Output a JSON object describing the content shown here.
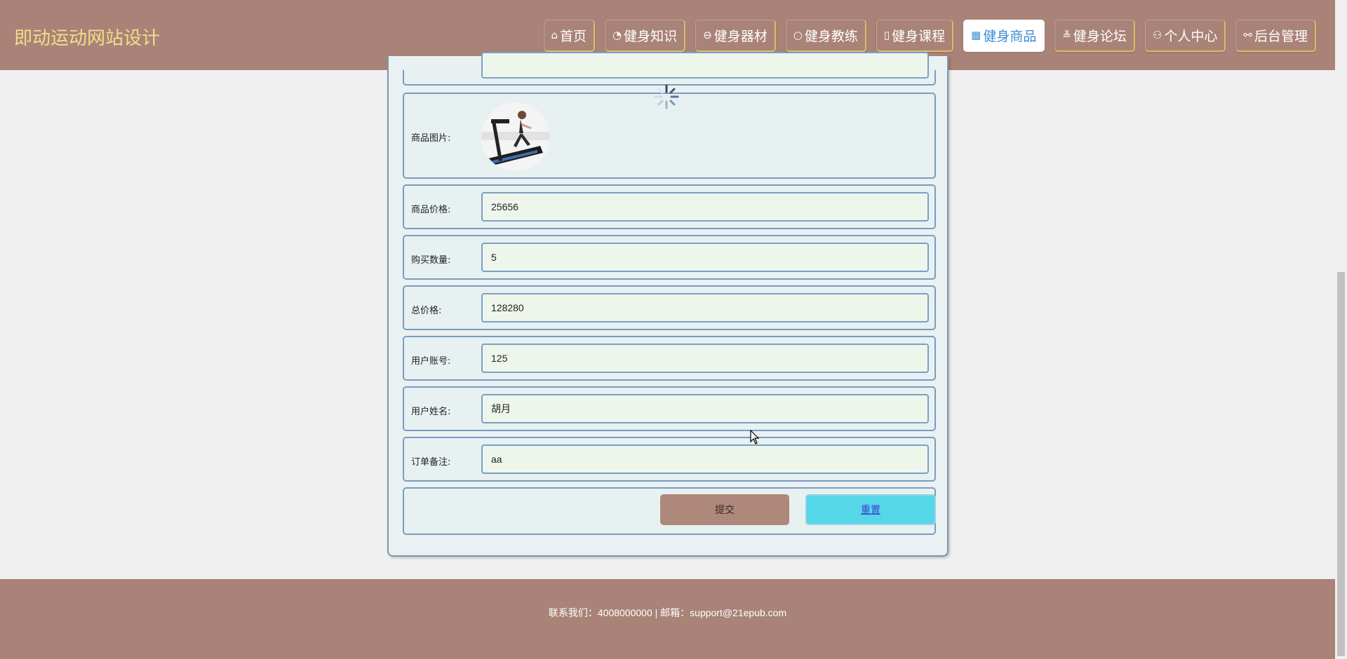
{
  "site": {
    "title": "即动运动网站设计"
  },
  "nav": [
    {
      "label": "首页",
      "icon": "home-icon",
      "glyph": "⌂"
    },
    {
      "label": "健身知识",
      "icon": "dashboard-icon",
      "glyph": "◔"
    },
    {
      "label": "健身器材",
      "icon": "equipment-icon",
      "glyph": "⊖"
    },
    {
      "label": "健身教练",
      "icon": "coach-icon",
      "glyph": "○"
    },
    {
      "label": "健身课程",
      "icon": "course-icon",
      "glyph": "▯"
    },
    {
      "label": "健身商品",
      "icon": "grid-icon",
      "glyph": "▦",
      "active": true
    },
    {
      "label": "健身论坛",
      "icon": "forum-icon",
      "glyph": "≚"
    },
    {
      "label": "个人中心",
      "icon": "user-icon",
      "glyph": "⚇"
    },
    {
      "label": "后台管理",
      "icon": "link-icon",
      "glyph": "⚯"
    }
  ],
  "form": {
    "image_label": "商品图片:",
    "price_label": "商品价格:",
    "price_value": "25656",
    "quantity_label": "购买数量:",
    "quantity_value": "5",
    "total_label": "总价格:",
    "total_value": "128280",
    "account_label": "用户账号:",
    "account_value": "125",
    "name_label": "用户姓名:",
    "name_value": "胡月",
    "remark_label": "订单备注:",
    "remark_value": "aa",
    "submit_label": "提交",
    "reset_label": "重置"
  },
  "footer": {
    "text": "联系我们：4008000000 | 邮箱：support@21epub.com"
  },
  "colors": {
    "header_bg": "#a98377",
    "title": "#f2dd8a",
    "active_nav_text": "#3d8dd4",
    "reset_btn": "#55d7e8"
  }
}
